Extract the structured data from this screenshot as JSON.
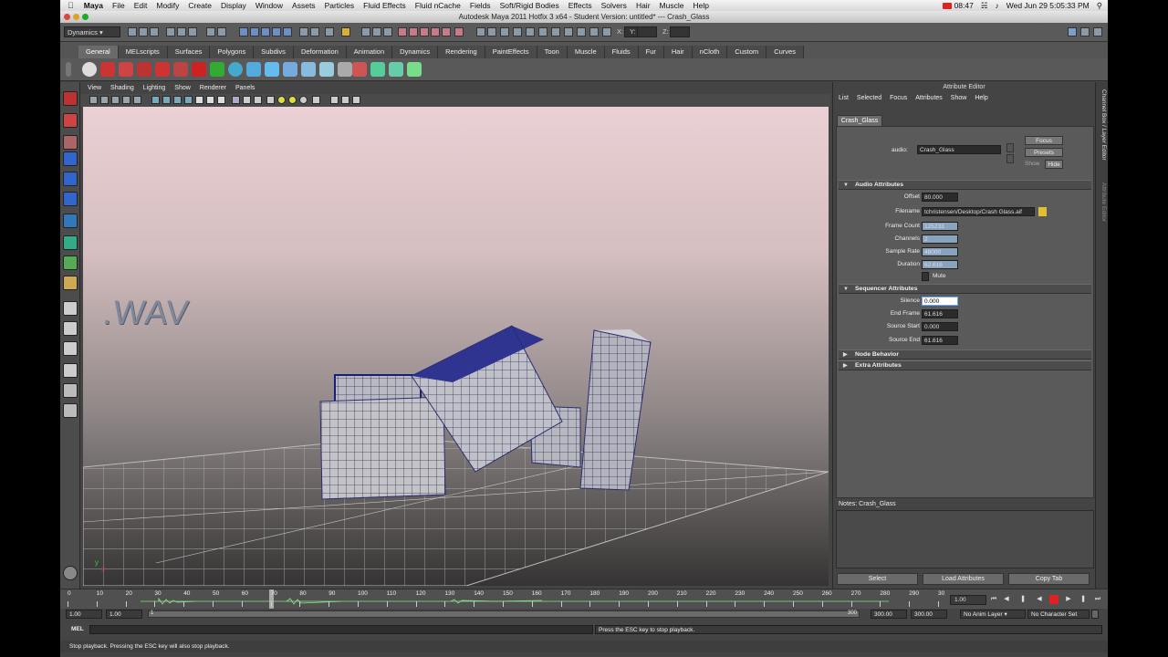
{
  "mac_menubar": {
    "apple": "",
    "app_name": "Maya",
    "items": [
      "File",
      "Edit",
      "Modify",
      "Create",
      "Display",
      "Window",
      "Assets",
      "Particles",
      "Fluid Effects",
      "Fluid nCache",
      "Fields",
      "Soft/Rigid Bodies",
      "Effects",
      "Solvers",
      "Hair",
      "Muscle",
      "Help"
    ],
    "recording_time": "08:47",
    "clock": "Wed Jun 29  5:05:33 PM"
  },
  "window": {
    "title": "Autodesk Maya 2011 Hotfix 3 x64 - Student Version: untitled*   ---   Crash_Glass"
  },
  "status_line": {
    "mode": "Dynamics",
    "x_label": "X:",
    "y_label": "Y:",
    "z_label": "Z:"
  },
  "shelf": {
    "tabs": [
      "General",
      "MELscripts",
      "Surfaces",
      "Polygons",
      "Subdivs",
      "Deformation",
      "Animation",
      "Dynamics",
      "Rendering",
      "PaintEffects",
      "Toon",
      "Muscle",
      "Fluids",
      "Fur",
      "Hair",
      "nCloth",
      "Custom",
      "Curves"
    ],
    "active_tab": "General"
  },
  "viewport": {
    "menu": [
      "View",
      "Shading",
      "Lighting",
      "Show",
      "Renderer",
      "Panels"
    ],
    "scene_text": ".WAV",
    "axis_y": "y",
    "axis_x": "x"
  },
  "attribute_editor": {
    "title": "Attribute Editor",
    "menu": [
      "List",
      "Selected",
      "Focus",
      "Attributes",
      "Show",
      "Help"
    ],
    "tab": "Crash_Glass",
    "node_label": "audio:",
    "node_name": "Crash_Glass",
    "focus_button": "Focus",
    "presets_button": "Presets",
    "show_label": "Show",
    "hide_button": "Hide",
    "audio_section": {
      "title": "Audio Attributes",
      "offset_label": "Offset",
      "offset": "80.000",
      "filename_label": "Filename",
      "filename": "tchristensen/Desktop/Crash Glass.aif",
      "frame_count_label": "Frame Count",
      "frame_count": "125233",
      "channels_label": "Channels",
      "channels": "2",
      "sample_rate_label": "Sample Rate",
      "sample_rate": "48000",
      "duration_label": "Duration",
      "duration": "62.616",
      "mute_label": "Mute"
    },
    "sequencer_section": {
      "title": "Sequencer Attributes",
      "silence_label": "Silence",
      "silence": "0.000",
      "end_frame_label": "End Frame",
      "end_frame": "61.616",
      "source_start_label": "Source Start",
      "source_start": "0.000",
      "source_end_label": "Source End",
      "source_end": "61.616"
    },
    "node_behavior": "Node Behavior",
    "extra_attributes": "Extra Attributes",
    "notes_label": "Notes:  Crash_Glass",
    "buttons": {
      "select": "Select",
      "load_attributes": "Load Attributes",
      "copy_tab": "Copy Tab"
    }
  },
  "side_tabs": [
    "Channel Box / Layer Editor",
    "Attribute Editor"
  ],
  "time_slider": {
    "ticks": [
      "0",
      "10",
      "20",
      "30",
      "40",
      "50",
      "60",
      "70",
      "80",
      "90",
      "100",
      "110",
      "120",
      "130",
      "140",
      "150",
      "160",
      "170",
      "180",
      "190",
      "200",
      "210",
      "220",
      "230",
      "240",
      "250",
      "260",
      "270",
      "280",
      "290",
      "30"
    ],
    "current_frame": "1.00",
    "playhead_frame": 70
  },
  "range_slider": {
    "start": "1.00",
    "start_inner": "1.00",
    "range_start_marker": "1",
    "range_end_marker": "300",
    "end_inner": "300.00",
    "end": "300.00",
    "anim_layer": "No Anim Layer",
    "character_set": "No Character Set"
  },
  "command_line": {
    "label": "MEL",
    "result": "Press the ESC key to stop playback."
  },
  "help_line": "Stop playback.  Pressing the ESC key will also stop playback.",
  "colors": {
    "viewport_top": "#ead0d4",
    "viewport_bottom": "#353333",
    "accent_red": "#d22222",
    "field_readonly": "#8aa3bd"
  }
}
